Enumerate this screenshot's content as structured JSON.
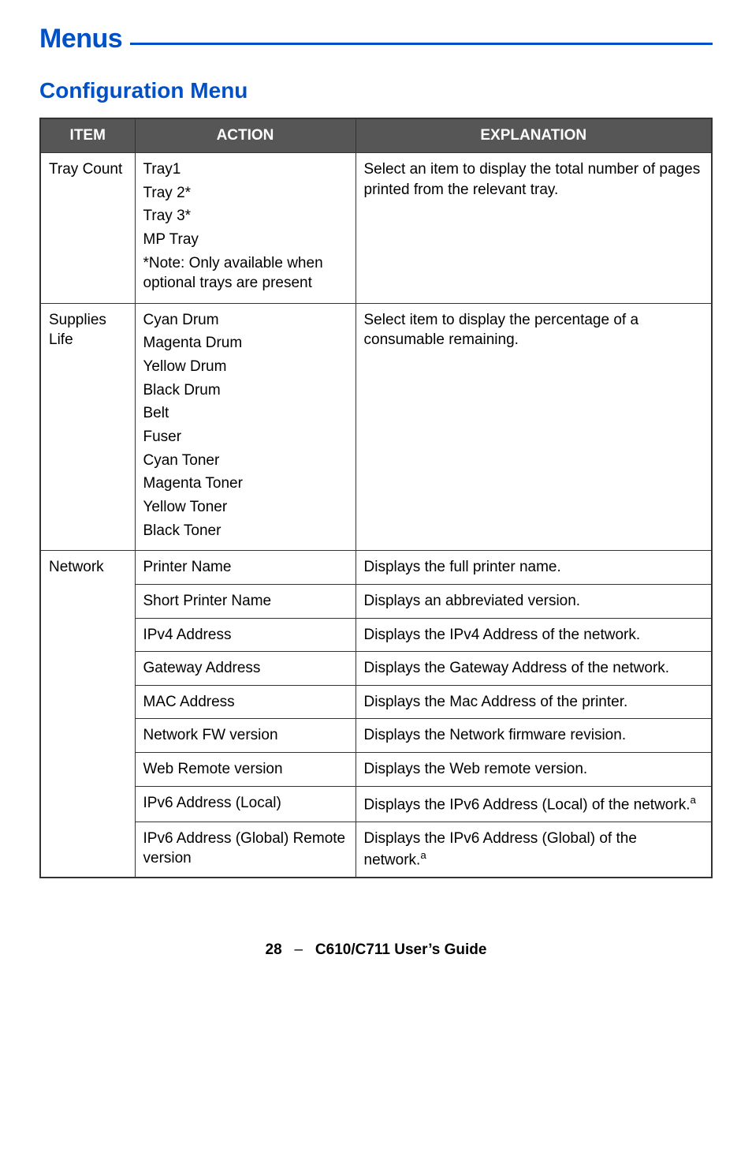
{
  "heading": "Menus",
  "section": "Configuration Menu",
  "columns": {
    "item": "ITEM",
    "action": "ACTION",
    "explanation": "EXPLANATION"
  },
  "rows": [
    {
      "item": "Tray Count",
      "actions": [
        "Tray1",
        "Tray 2*",
        "Tray 3*",
        "MP Tray",
        "*Note: Only available when optional trays are present"
      ],
      "explanation": "Select an item to display the total number of pages printed from the relevant tray."
    },
    {
      "item": "Supplies Life",
      "actions": [
        "Cyan Drum",
        "Magenta Drum",
        "Yellow Drum",
        "Black Drum",
        "Belt",
        "Fuser",
        "Cyan Toner",
        "Magenta Toner",
        "Yellow Toner",
        "Black Toner"
      ],
      "explanation": "Select item to display the percentage of a consumable remaining."
    },
    {
      "item": "Network",
      "pairs": [
        {
          "action": "Printer Name",
          "explanation": "Displays the full printer name."
        },
        {
          "action": "Short Printer Name",
          "explanation": "Displays an abbreviated version."
        },
        {
          "action": "IPv4 Address",
          "explanation": "Displays the IPv4 Address of the network."
        },
        {
          "action": "Gateway Address",
          "explanation": "Displays the Gateway Address of the network."
        },
        {
          "action": "MAC Address",
          "explanation": "Displays the Mac Address of the printer."
        },
        {
          "action": "Network FW version",
          "explanation": "Displays the Network firmware revision."
        },
        {
          "action": "Web Remote version",
          "explanation": "Displays the Web remote version."
        },
        {
          "action": "IPv6 Address (Local)",
          "explanation": "Displays the IPv6 Address (Local) of the network.",
          "sup": "a"
        },
        {
          "action": "IPv6 Address (Global) Remote version",
          "explanation": "Displays the IPv6 Address (Global) of the network.",
          "sup": "a"
        }
      ]
    }
  ],
  "footer": {
    "page": "28",
    "sep": "–",
    "title": "C610/C711 User’s Guide"
  }
}
